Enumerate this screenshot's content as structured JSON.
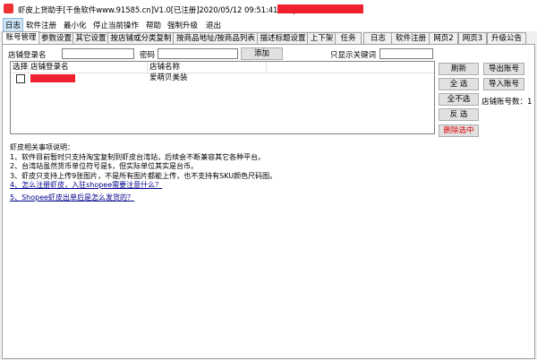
{
  "window": {
    "title": "虾皮上货助手[千鱼软件www.91585.cn]V1.0[已注册]2020/05/12 09:51:41到期|",
    "icon": "app-icon"
  },
  "menu": [
    "日志",
    "软件注册",
    "最小化",
    "停止当前操作",
    "帮助",
    "强制升级",
    "退出"
  ],
  "tabs": [
    "账号管理",
    "参数设置",
    "其它设置",
    "按店铺或分类复制",
    "按商品地址/按商品列表",
    "描述标题设置",
    "上下架",
    "任务",
    "日志",
    "软件注册",
    "网页2",
    "网页3",
    "升级公告"
  ],
  "form": {
    "store_login_label": "店铺登录名",
    "password_label": "密码",
    "add_button": "添加",
    "keyword_filter_label": "只显示关键词"
  },
  "table": {
    "columns": [
      "选择",
      "店铺登录名",
      "店铺名称"
    ],
    "rows": [
      {
        "checked": false,
        "store_name": "爱萌贝美装"
      }
    ]
  },
  "buttons": {
    "refresh": "刷新",
    "export": "导出账号",
    "select_all": "全 选",
    "import": "导入账号",
    "deselect_all": "全不选",
    "invert": "反 选",
    "delete_selected": "删除选中",
    "account_count_label": "店铺账号数：1"
  },
  "notes": {
    "heading": "虾皮相关事项说明：",
    "items": [
      "1、软件目前暂时只支持淘宝复制到虾皮台湾站，后续会不断兼容其它各种平台。",
      "2、台湾站虽然货币单位符号是$，但实际单位其实是台币。",
      "3、虾皮只支持上传9张图片，不是所有图片都能上传，也不支持有SKU颜色尺码图。"
    ],
    "links": [
      "4、怎么注册虾皮，入驻shopee需要注意什么？",
      "5、Shopee虾皮出单后是怎么发货的？"
    ]
  },
  "colors": {
    "redaction": "#f02030",
    "delete_text": "#d00000",
    "link": "#00008b"
  }
}
